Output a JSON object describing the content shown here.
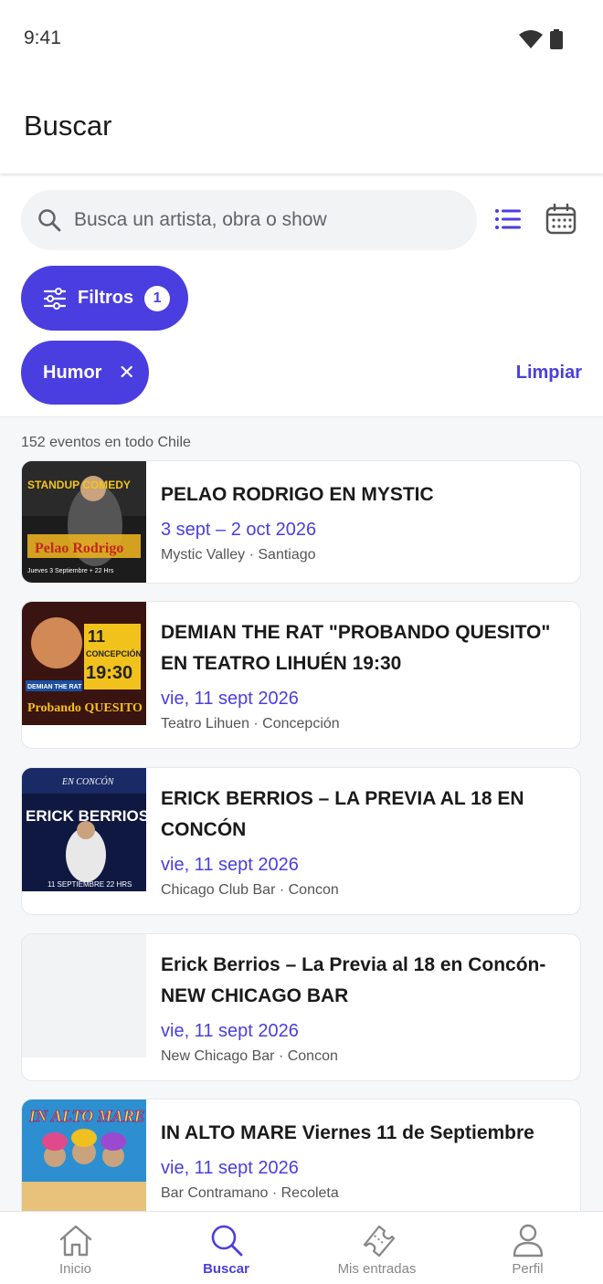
{
  "status": {
    "time": "9:41"
  },
  "appbar": {
    "title": "Buscar"
  },
  "search": {
    "placeholder": "Busca un artista, obra o show"
  },
  "filters": {
    "label": "Filtros",
    "count": "1"
  },
  "active_chip": {
    "label": "Humor"
  },
  "clear_label": "Limpiar",
  "results_count": "152 eventos en todo Chile",
  "events": [
    {
      "title": "PELAO RODRIGO EN MYSTIC",
      "date": "3 sept – 2 oct 2026",
      "venue": "Mystic Valley · Santiago"
    },
    {
      "title": "DEMIAN THE RAT \"PROBANDO QUESITO\" EN TEATRO LIHUÉN 19:30",
      "date": "vie, 11 sept 2026",
      "venue": "Teatro Lihuen · Concepción"
    },
    {
      "title": "ERICK BERRIOS – LA PREVIA AL 18 EN CONCÓN",
      "date": "vie, 11 sept 2026",
      "venue": "Chicago Club Bar · Concon"
    },
    {
      "title": "Erick Berrios – La Previa al 18 en Concón-NEW CHICAGO BAR",
      "date": "vie, 11 sept 2026",
      "venue": "New Chicago Bar · Concon"
    },
    {
      "title": "IN ALTO MARE Viernes 11 de Septiembre",
      "date": "vie, 11 sept 2026",
      "venue": "Bar Contramano · Recoleta"
    }
  ],
  "posters": {
    "p1": {
      "l1": "STANDUP COMEDY",
      "l2": "Pelao Rodrigo",
      "l3": "Jueves 3 Septiembre + 22 Hrs"
    },
    "p2": {
      "l1": "11",
      "l2": "CONCEPCIÓN",
      "l3": "19:30",
      "l4": "DEMIAN THE RAT",
      "l5": "Probando QUESITO"
    },
    "p3": {
      "l1": "EN CONCÓN",
      "l2": "ERICK BERRIOS",
      "l3": "11 SEPTIEMBRE  22 HRS"
    },
    "p5": {
      "l1": "IN ALTO MARE"
    }
  },
  "nav": [
    {
      "label": "Inicio",
      "icon": "home-icon"
    },
    {
      "label": "Buscar",
      "icon": "search-icon"
    },
    {
      "label": "Mis entradas",
      "icon": "ticket-icon"
    },
    {
      "label": "Perfil",
      "icon": "user-icon"
    }
  ],
  "colors": {
    "accent": "#4a3ee0",
    "muted": "#888888"
  }
}
